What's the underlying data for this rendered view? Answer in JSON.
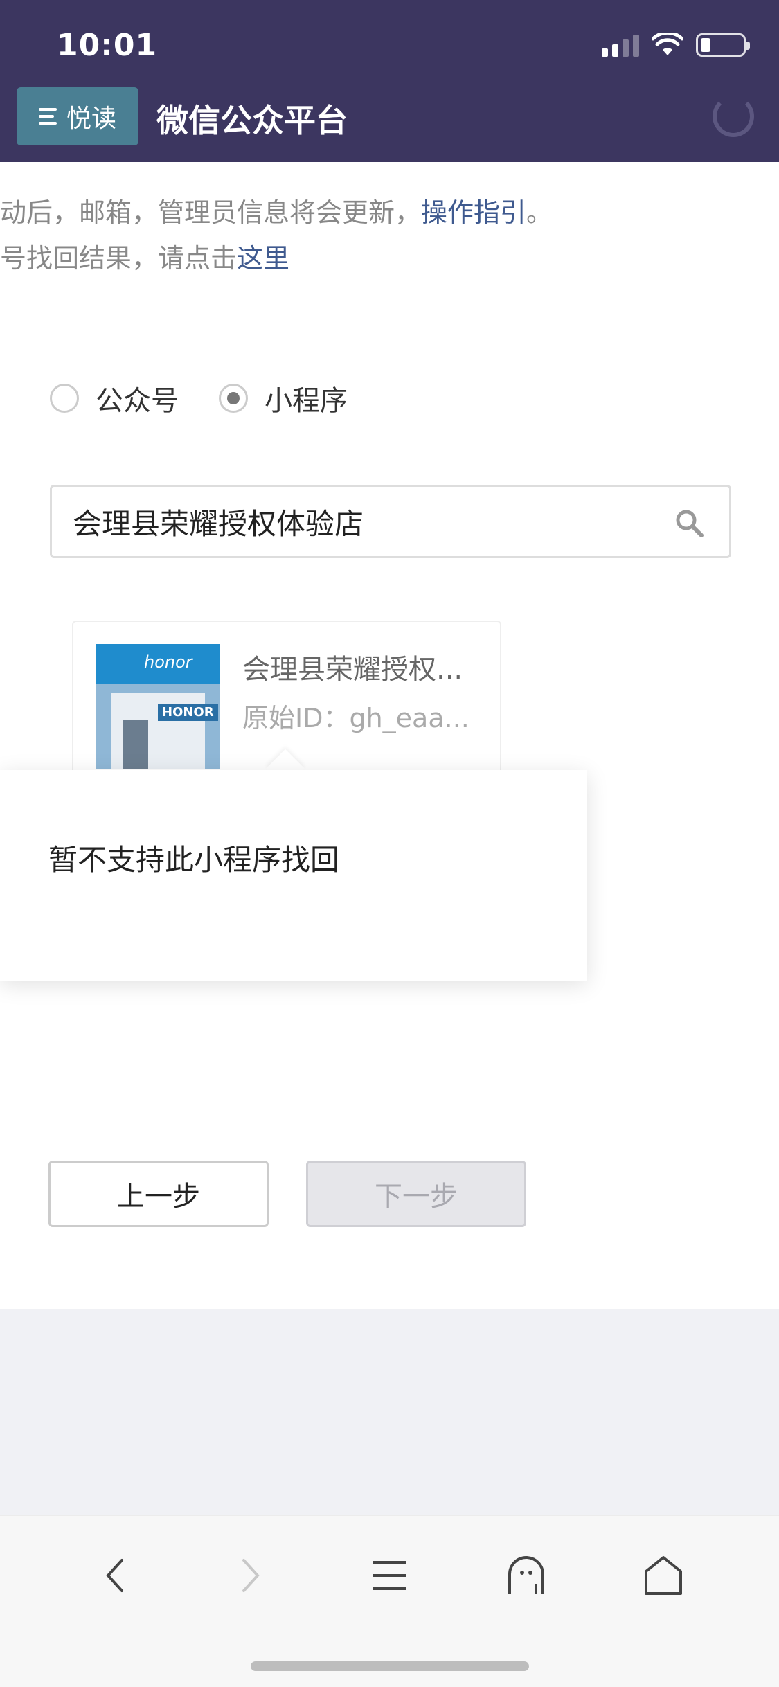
{
  "status_bar": {
    "time": "10:01"
  },
  "header": {
    "reader_button_label": "悦读",
    "title": "微信公众平台"
  },
  "notice": {
    "line1_text": "动后，邮箱，管理员信息将会更新，",
    "line1_link": "操作指引",
    "line1_end": "。",
    "line2_text": "号找回结果，请点击",
    "line2_link": "这里"
  },
  "account_type": {
    "options": [
      {
        "label": "公众号",
        "selected": false
      },
      {
        "label": "小程序",
        "selected": true
      }
    ]
  },
  "search": {
    "value": "会理县荣耀授权体验店"
  },
  "result": {
    "name": "会理县荣耀授权...",
    "id_label": "原始ID：",
    "id_value": "gh_eaa..."
  },
  "tooltip": {
    "message": "暂不支持此小程序找回"
  },
  "buttons": {
    "prev": "上一步",
    "next": "下一步"
  },
  "colors": {
    "header_bg": "#3c3660",
    "reader_btn_bg": "#4a7f93",
    "link": "#3f5a8f"
  }
}
